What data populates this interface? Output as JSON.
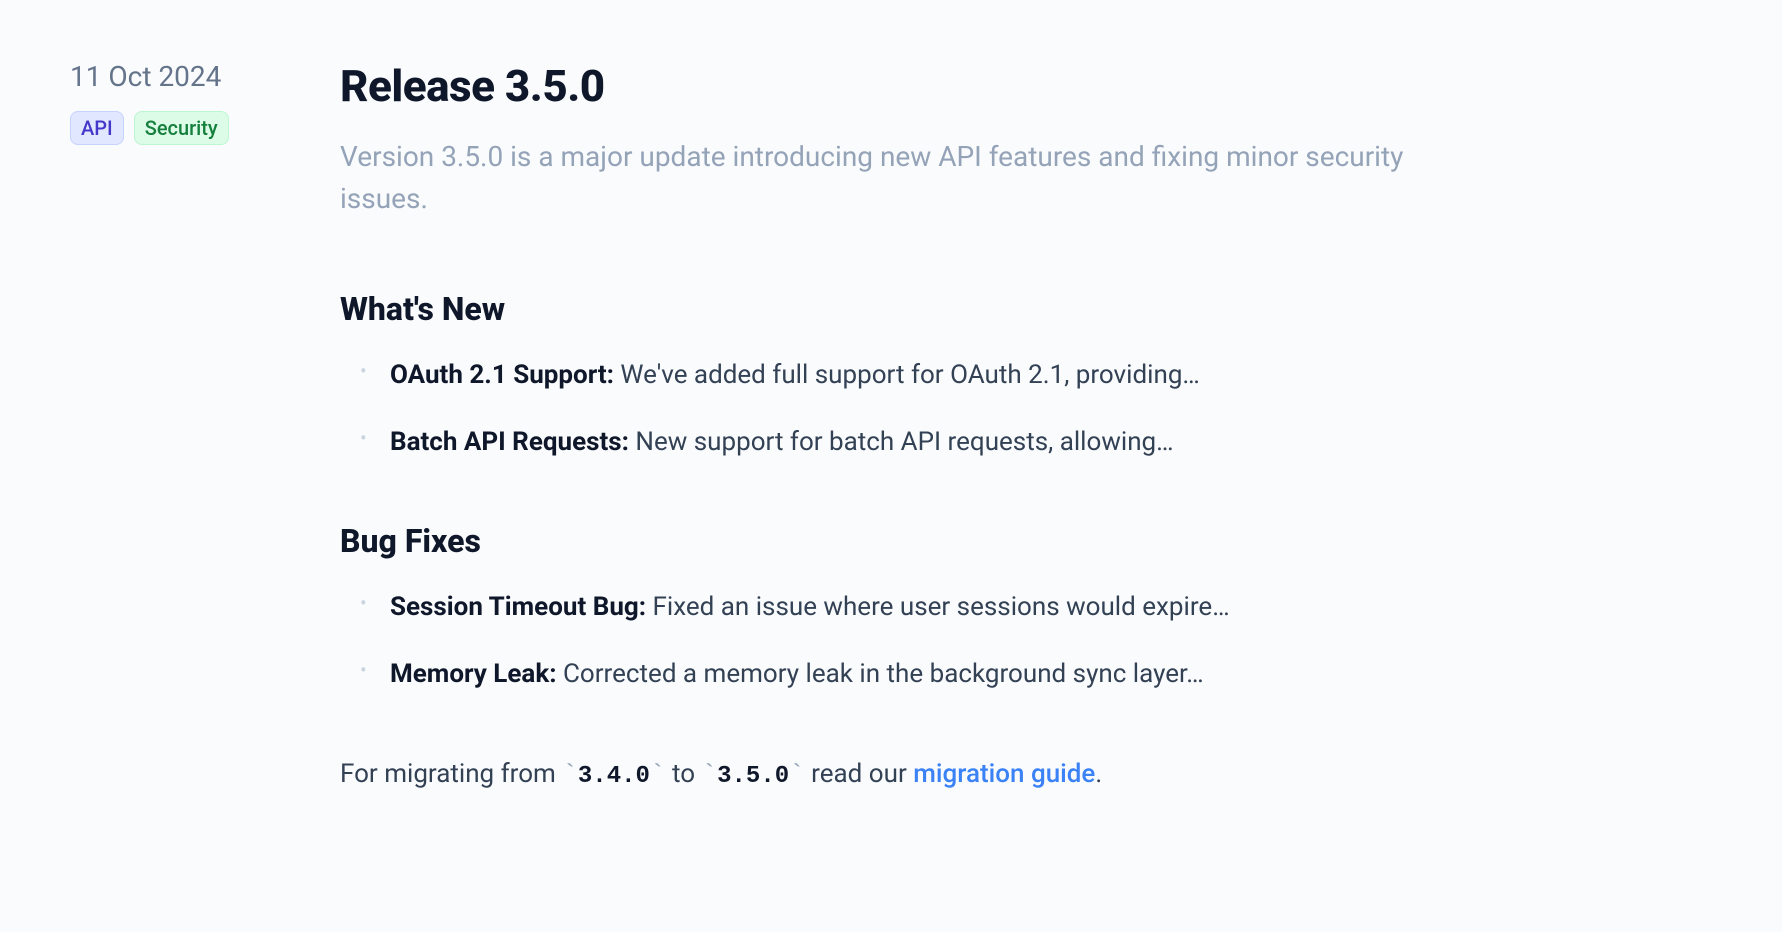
{
  "sidebar": {
    "date": "11 Oct 2024",
    "tags": [
      {
        "label": "API",
        "type": "api"
      },
      {
        "label": "Security",
        "type": "security"
      }
    ]
  },
  "title": "Release 3.5.0",
  "description": "Version 3.5.0 is a major update introducing new API features and fixing minor security issues.",
  "sections": [
    {
      "heading": "What's New",
      "items": [
        {
          "title": "OAuth 2.1 Support:",
          "text": " We've added full support for OAuth 2.1, providing…"
        },
        {
          "title": "Batch API Requests:",
          "text": " New support for batch API requests, allowing…"
        }
      ]
    },
    {
      "heading": "Bug Fixes",
      "items": [
        {
          "title": "Session Timeout Bug:",
          "text": " Fixed an issue where user sessions would expire…"
        },
        {
          "title": "Memory Leak:",
          "text": " Corrected a memory leak in the background sync layer…"
        }
      ]
    }
  ],
  "footer": {
    "prefix": "For migrating from ",
    "code1": "3.5.0",
    "code0": "3.4.0",
    "middle": " to ",
    "suffix": " read our ",
    "link_text": "migration guide",
    "end": "."
  }
}
